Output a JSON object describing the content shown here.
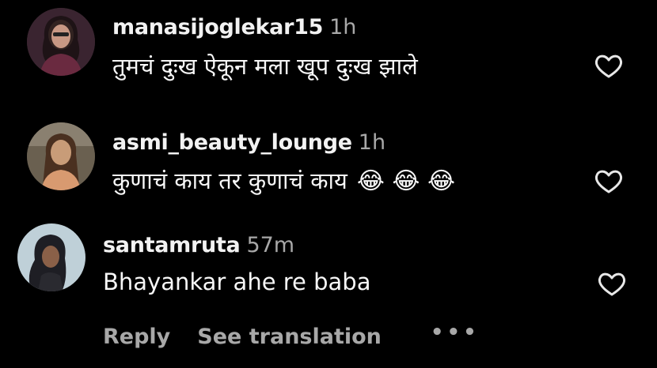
{
  "comments": [
    {
      "username": "manasijoglekar15",
      "time": "1h",
      "text": "तुमचं दुःख ऐकून मला खूप दुःख झाले",
      "emojis": "",
      "avatar_colors": {
        "bg": "#3a2430",
        "fg": "#b88a78"
      }
    },
    {
      "username": "asmi_beauty_lounge",
      "time": "1h",
      "text": "कुणाचं काय तर कुणाचं काय",
      "emojis": "😂 😂 😂",
      "avatar_colors": {
        "bg": "#6a6050",
        "fg": "#c89c78"
      }
    },
    {
      "username": "santamruta",
      "time": "57m",
      "text": "Bhayankar ahe re baba",
      "emojis": "",
      "avatar_colors": {
        "bg": "#bfd0d8",
        "fg": "#2a2a30"
      }
    }
  ],
  "actions": {
    "reply": "Reply",
    "see_translation": "See translation",
    "more": "•••"
  },
  "icons": {
    "like": "heart-outline-icon",
    "more": "more-options-icon"
  }
}
